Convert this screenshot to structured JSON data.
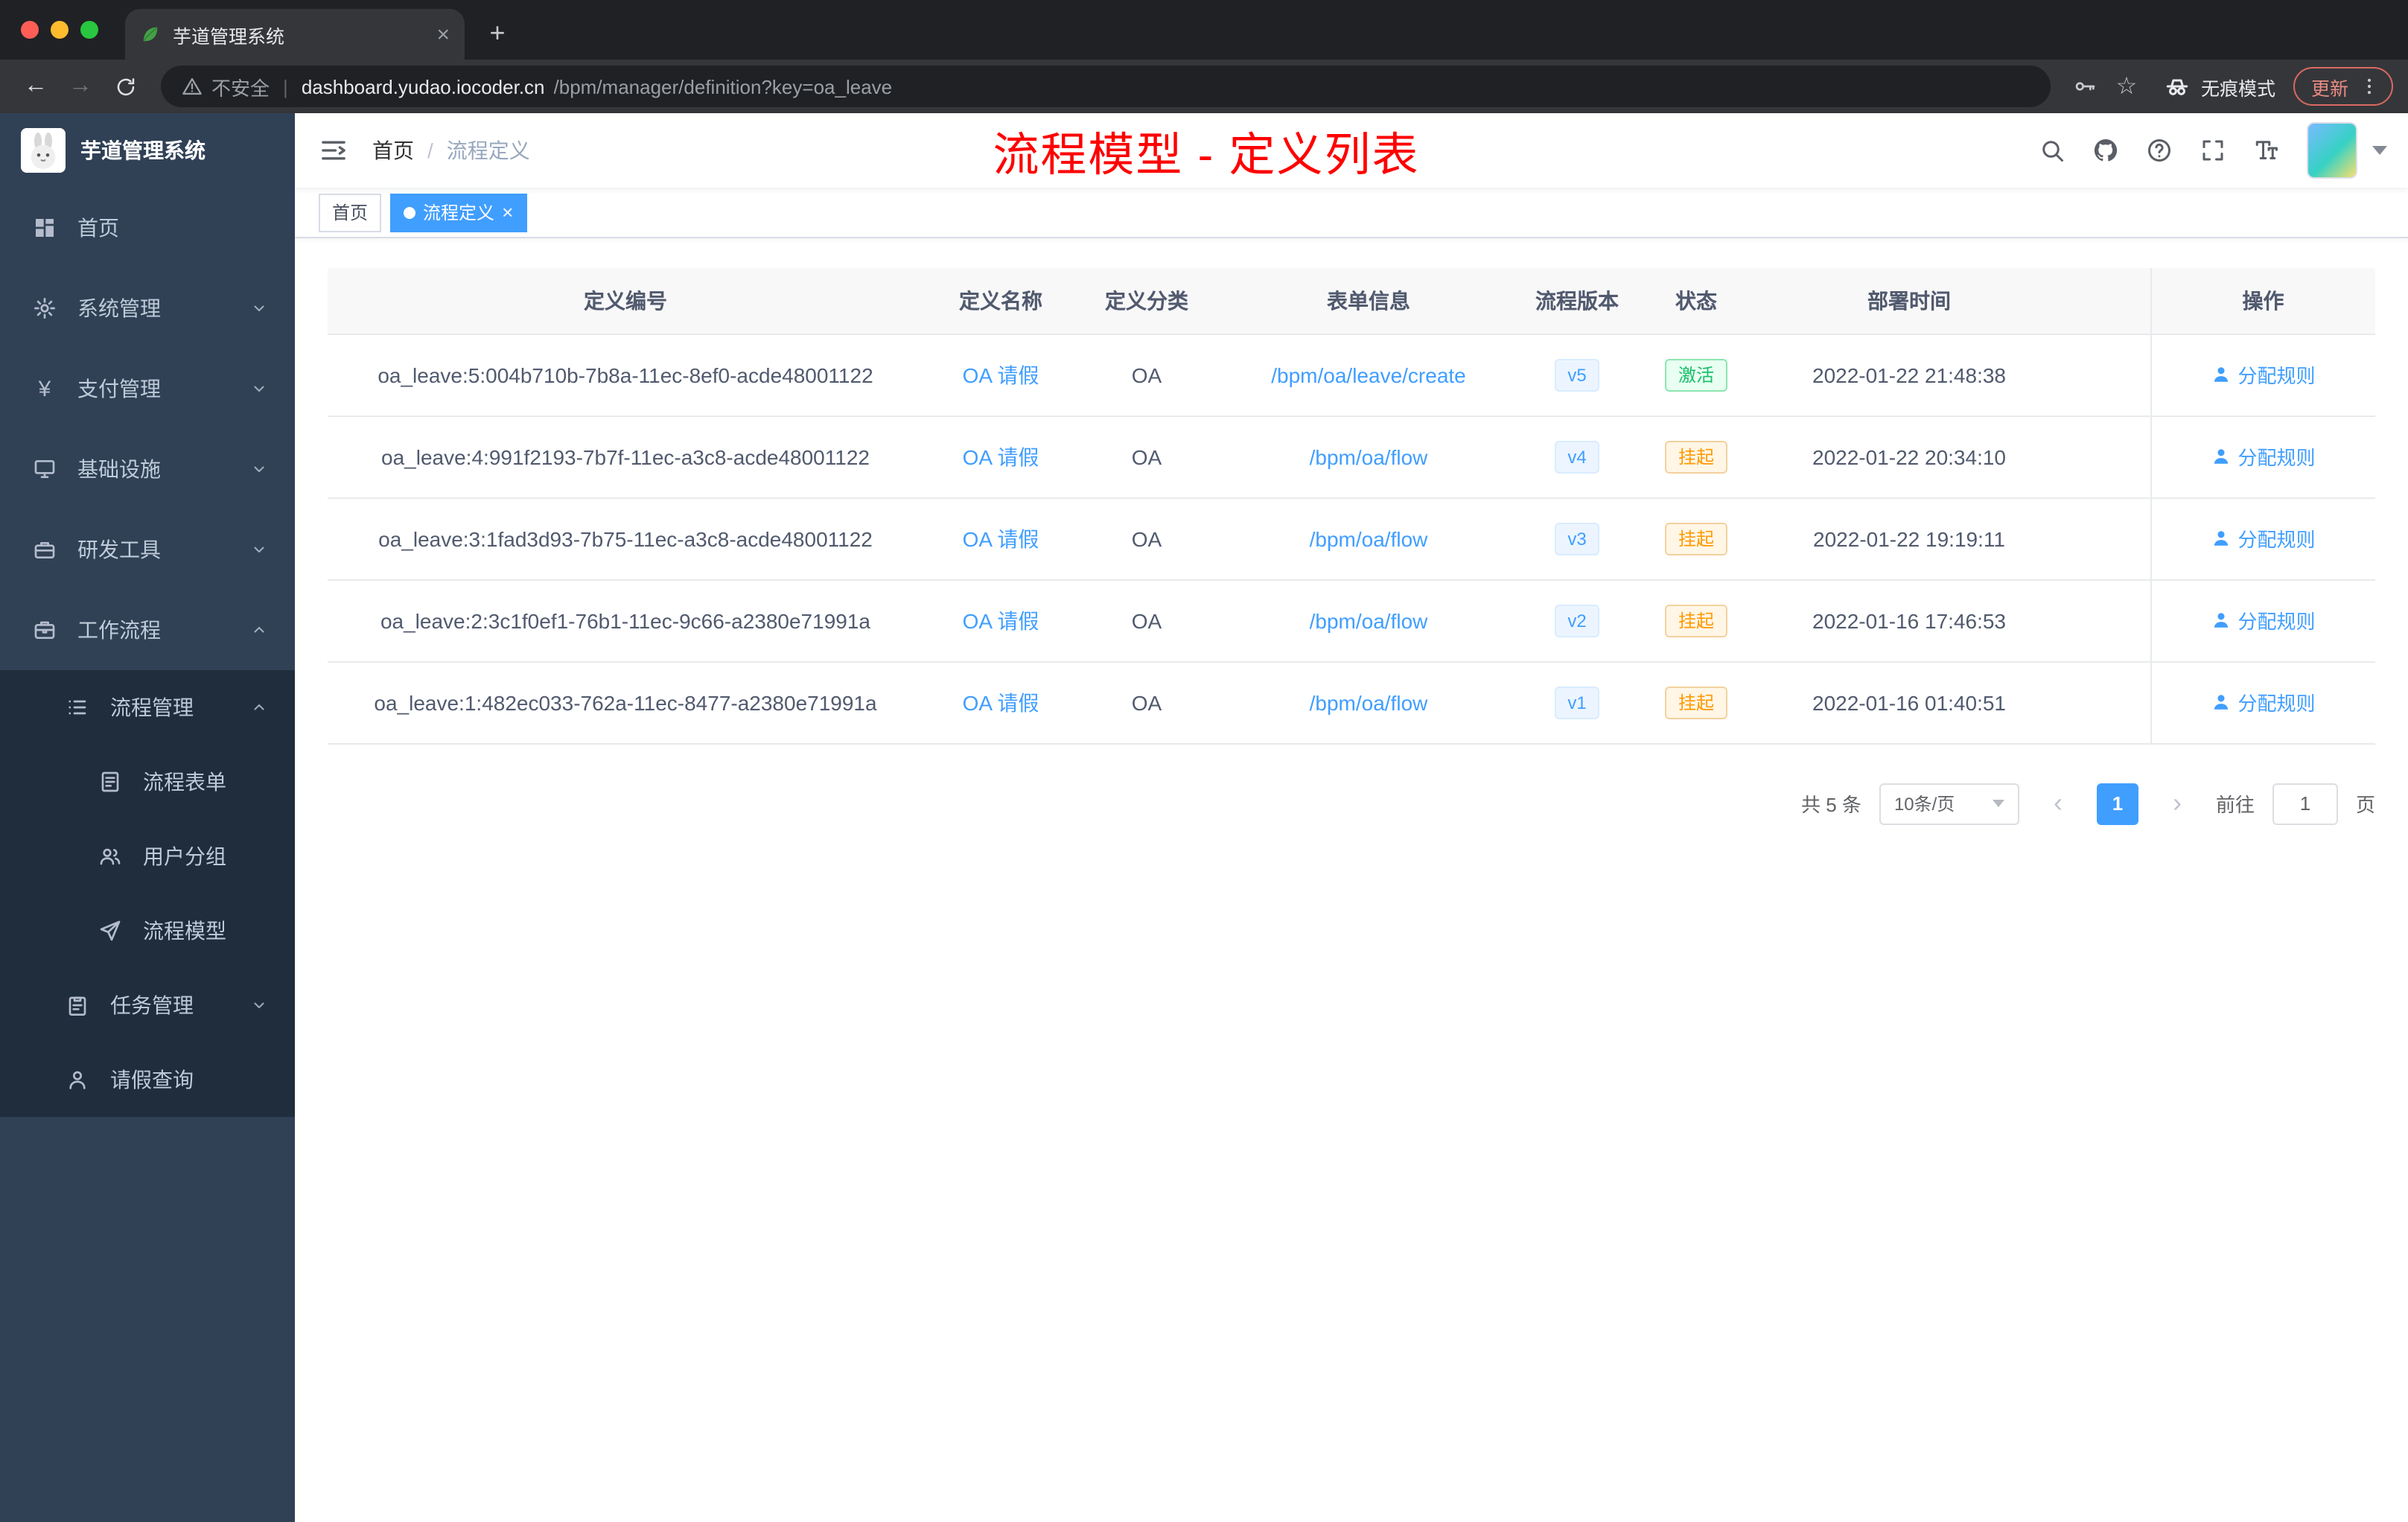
{
  "browser": {
    "tab_title": "芋道管理系统",
    "security_label": "不安全",
    "url_domain": "dashboard.yudao.iocoder.cn",
    "url_path": "/bpm/manager/definition?key=oa_leave",
    "incognito_label": "无痕模式",
    "update_label": "更新"
  },
  "icons": {
    "close": "×",
    "plus": "+",
    "back": "←",
    "forward": "→",
    "star": "☆",
    "prev": "‹",
    "next": "›",
    "divider": "|"
  },
  "sidebar": {
    "title": "芋道管理系统",
    "items": [
      {
        "key": "home",
        "label": "首页",
        "icon": "dashboard",
        "level": 0
      },
      {
        "key": "system",
        "label": "系统管理",
        "icon": "gear",
        "level": 0,
        "arrow": "down"
      },
      {
        "key": "payment",
        "label": "支付管理",
        "icon": "yen",
        "level": 0,
        "arrow": "down"
      },
      {
        "key": "infrastructure",
        "label": "基础设施",
        "icon": "infra",
        "level": 0,
        "arrow": "down"
      },
      {
        "key": "dev-tools",
        "label": "研发工具",
        "icon": "tools",
        "level": 0,
        "arrow": "down"
      },
      {
        "key": "workflow",
        "label": "工作流程",
        "icon": "workflow",
        "level": 0,
        "arrow": "up"
      },
      {
        "key": "process-mgmt",
        "label": "流程管理",
        "icon": "process",
        "level": 1,
        "arrow": "up",
        "sub": true
      },
      {
        "key": "process-form",
        "label": "流程表单",
        "icon": "form",
        "level": 2,
        "sub": true
      },
      {
        "key": "user-group",
        "label": "用户分组",
        "icon": "group",
        "level": 2,
        "sub": true
      },
      {
        "key": "process-model",
        "label": "流程模型",
        "icon": "model",
        "level": 2,
        "sub": true
      },
      {
        "key": "task-mgmt",
        "label": "任务管理",
        "icon": "task",
        "level": 1,
        "arrow": "down",
        "sub": true
      },
      {
        "key": "leave-query",
        "label": "请假查询",
        "icon": "person",
        "level": 1,
        "sub": true
      }
    ]
  },
  "header": {
    "breadcrumb": [
      "首页",
      "流程定义"
    ],
    "breadcrumb_separator": "/",
    "annotation": "流程模型 - 定义列表"
  },
  "tags": [
    {
      "label": "首页",
      "active": false,
      "closable": false
    },
    {
      "label": "流程定义",
      "active": true,
      "closable": true
    }
  ],
  "table": {
    "columns": [
      "定义编号",
      "定义名称",
      "定义分类",
      "表单信息",
      "流程版本",
      "状态",
      "部署时间",
      "操作"
    ],
    "action_label": "分配规则",
    "rows": [
      {
        "id": "oa_leave:5:004b710b-7b8a-11ec-8ef0-acde48001122",
        "name": "OA 请假",
        "category": "OA",
        "form": "/bpm/oa/leave/create",
        "version": "v5",
        "status": "激活",
        "status_type": "success",
        "time": "2022-01-22 21:48:38"
      },
      {
        "id": "oa_leave:4:991f2193-7b7f-11ec-a3c8-acde48001122",
        "name": "OA 请假",
        "category": "OA",
        "form": "/bpm/oa/flow",
        "version": "v4",
        "status": "挂起",
        "status_type": "warning",
        "time": "2022-01-22 20:34:10"
      },
      {
        "id": "oa_leave:3:1fad3d93-7b75-11ec-a3c8-acde48001122",
        "name": "OA 请假",
        "category": "OA",
        "form": "/bpm/oa/flow",
        "version": "v3",
        "status": "挂起",
        "status_type": "warning",
        "time": "2022-01-22 19:19:11"
      },
      {
        "id": "oa_leave:2:3c1f0ef1-76b1-11ec-9c66-a2380e71991a",
        "name": "OA 请假",
        "category": "OA",
        "form": "/bpm/oa/flow",
        "version": "v2",
        "status": "挂起",
        "status_type": "warning",
        "time": "2022-01-16 17:46:53"
      },
      {
        "id": "oa_leave:1:482ec033-762a-11ec-8477-a2380e71991a",
        "name": "OA 请假",
        "category": "OA",
        "form": "/bpm/oa/flow",
        "version": "v1",
        "status": "挂起",
        "status_type": "warning",
        "time": "2022-01-16 01:40:51"
      }
    ]
  },
  "pagination": {
    "total": "共 5 条",
    "size": "10条/页",
    "current": "1",
    "goto_label": "前往",
    "goto_value": "1",
    "page_suffix": "页"
  },
  "colors": {
    "accent": "#409EFF",
    "success": "#19be6b",
    "warning": "#ff9900",
    "annotation": "#ff0000",
    "sidebar": "#304156",
    "sidebar_sub": "#1f2d3d"
  }
}
